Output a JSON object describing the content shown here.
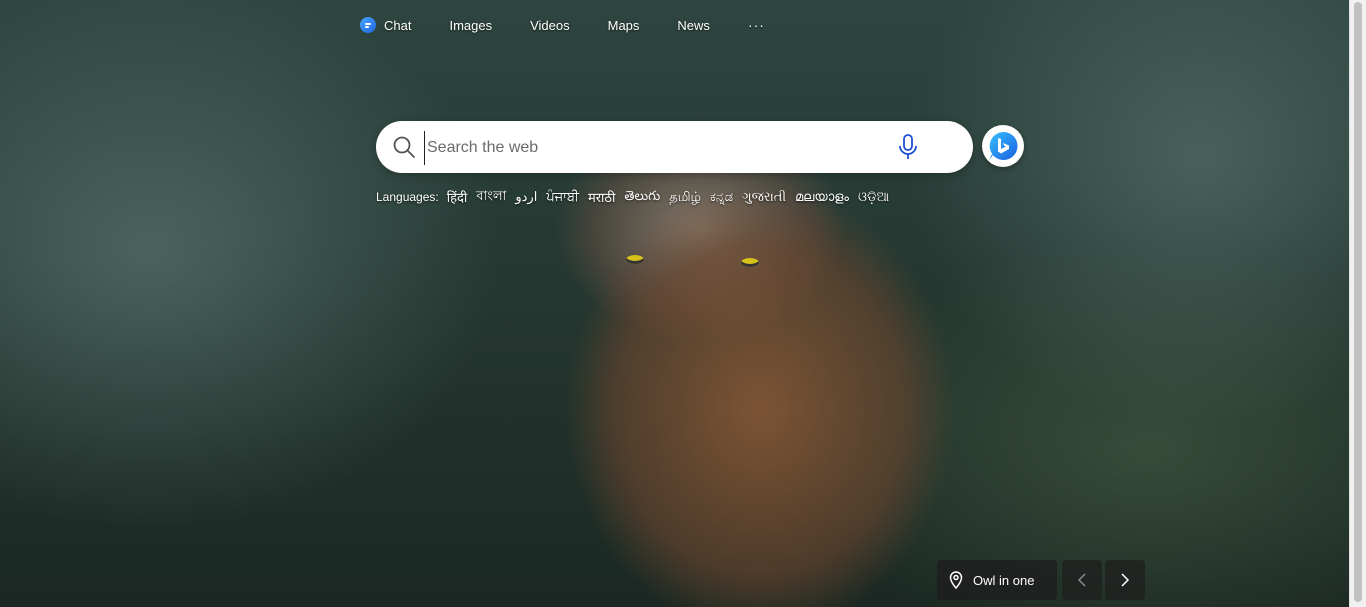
{
  "nav": {
    "items": [
      {
        "label": "Chat",
        "icon": "chat-icon"
      },
      {
        "label": "Images"
      },
      {
        "label": "Videos"
      },
      {
        "label": "Maps"
      },
      {
        "label": "News"
      }
    ],
    "more_label": "···"
  },
  "search": {
    "placeholder": "Search the web",
    "value": "",
    "icon": "search-icon",
    "mic_icon": "microphone-icon"
  },
  "bing_button": {
    "icon": "bing-logo-icon"
  },
  "languages": {
    "label": "Languages:",
    "items": [
      "हिंदी",
      "বাংলা",
      "اردو",
      "ਪੰਜਾਬੀ",
      "मराठी",
      "తెలుగు",
      "தமிழ்",
      "ಕನ್ನಡ",
      "ગુજરાતી",
      "മലയാളം",
      "ଓଡ଼ିଆ"
    ]
  },
  "image_caption": {
    "label": "Owl in one",
    "icon": "location-pin-icon"
  },
  "colors": {
    "accent": "#1f66e0"
  }
}
